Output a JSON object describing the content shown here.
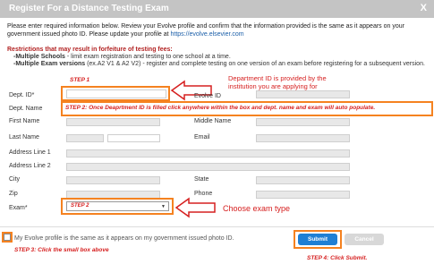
{
  "dialog": {
    "title": "Register For a Distance Testing Exam",
    "close_label": "X"
  },
  "intro": {
    "text": "Please enter required information below. Review your Evolve profile and confirm that the information provided is the same as it appears on your government issued photo ID. Please update your profile at ",
    "link": "https://evolve.elsevier.com"
  },
  "restrictions": {
    "heading": "Restrictions that may result in forfeiture of testing fees:",
    "schools_label": "-Multiple Schools",
    "schools_text": " - limit exam registration and testing to one school at a time.",
    "versions_label": "-Multiple Exam versions",
    "versions_text": " (ex.A2 V1 & A2 V2) - register and complete testing on one version of an exam before registering for a subsequent version."
  },
  "form": {
    "dept_id_label": "Dept. ID*",
    "evolve_id_label": "Evolve ID",
    "dept_name_label": "Dept. Name",
    "first_name_label": "First Name",
    "middle_name_label": "Middle Name",
    "last_name_label": "Last Name",
    "email_label": "Email",
    "address1_label": "Address Line 1",
    "address2_label": "Address Line 2",
    "city_label": "City",
    "state_label": "State",
    "zip_label": "Zip",
    "phone_label": "Phone",
    "exam_label": "Exam*",
    "exam_selected": "STEP 2",
    "confirm_text": "My Evolve profile is the same as it appears on my government issued photo ID.",
    "submit_label": "Submit",
    "cancel_label": "Cancel"
  },
  "annotations": {
    "step1": "STEP 1",
    "dept_id_note": "Department ID is provided by the institution you are applying for",
    "step2_note": "STEP 2: Once Deaprtment ID is filled click anywhere within the box and dept. name and exam will auto populate.",
    "exam_note": "Choose exam type",
    "step3": "STEP 3: Click the small box above",
    "step4": "STEP 4: Click Submit."
  },
  "colors": {
    "annotation_red": "#d62020",
    "highlight_orange": "#f58220",
    "submit_blue": "#1f7fd4"
  }
}
